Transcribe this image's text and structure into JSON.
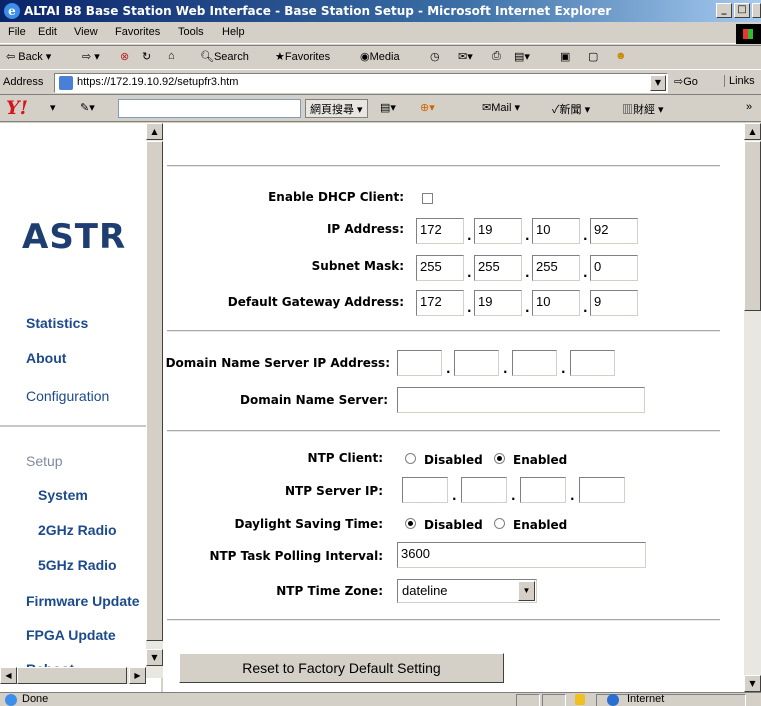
{
  "window": {
    "title": "ALTAI B8 Base Station Web Interface - Base Station Setup - Microsoft Internet Explorer",
    "minimize": "_",
    "maximize": "□"
  },
  "menubar": [
    "File",
    "Edit",
    "View",
    "Favorites",
    "Tools",
    "Help"
  ],
  "toolbar": {
    "back": "Back",
    "search": "Search",
    "favorites": "Favorites",
    "media": "Media"
  },
  "address": {
    "label": "Address",
    "url": "https://172.19.10.92/setupfr3.htm",
    "go": "Go",
    "links": "Links"
  },
  "yahoo_toolbar": {
    "logo": "Y!",
    "search_button": "網頁搜尋",
    "mail": "Mail",
    "news": "新聞",
    "finance": "財經"
  },
  "left_nav": {
    "logo": "ASTR",
    "items": [
      {
        "label": "Statistics"
      },
      {
        "label": "About"
      },
      {
        "label": "Configuration"
      },
      {
        "label": "Setup"
      },
      {
        "label": "System"
      },
      {
        "label": "2GHz Radio"
      },
      {
        "label": "5GHz Radio"
      },
      {
        "label": "Firmware Update"
      },
      {
        "label": "FPGA Update"
      },
      {
        "label": "Reboot"
      }
    ]
  },
  "form": {
    "dhcp_label": "Enable DHCP Client:",
    "dhcp_checked": false,
    "ip_label": "IP Address:",
    "ip": [
      "172",
      "19",
      "10",
      "92"
    ],
    "mask_label": "Subnet Mask:",
    "mask": [
      "255",
      "255",
      "255",
      "0"
    ],
    "gateway_label": "Default Gateway Address:",
    "gateway": [
      "172",
      "19",
      "10",
      "9"
    ],
    "dns_ip_label": "Domain Name Server IP Address:",
    "dns_ip": [
      "",
      "",
      "",
      ""
    ],
    "dns_label": "Domain Name Server:",
    "dns": "",
    "ntp_client_label": "NTP Client:",
    "ntp_client_options": [
      "Disabled",
      "Enabled"
    ],
    "ntp_client_selected": "Enabled",
    "ntp_server_label": "NTP Server IP:",
    "ntp_server": [
      "",
      "",
      "",
      ""
    ],
    "dst_label": "Daylight Saving Time:",
    "dst_options": [
      "Disabled",
      "Enabled"
    ],
    "dst_selected": "Disabled",
    "ntp_poll_label": "NTP Task Polling Interval:",
    "ntp_poll": "3600",
    "ntp_zone_label": "NTP Time Zone:",
    "ntp_zone": "dateline",
    "reset_button": "Reset to Factory Default Setting"
  },
  "status": {
    "text": "Done",
    "zone": "Internet"
  }
}
